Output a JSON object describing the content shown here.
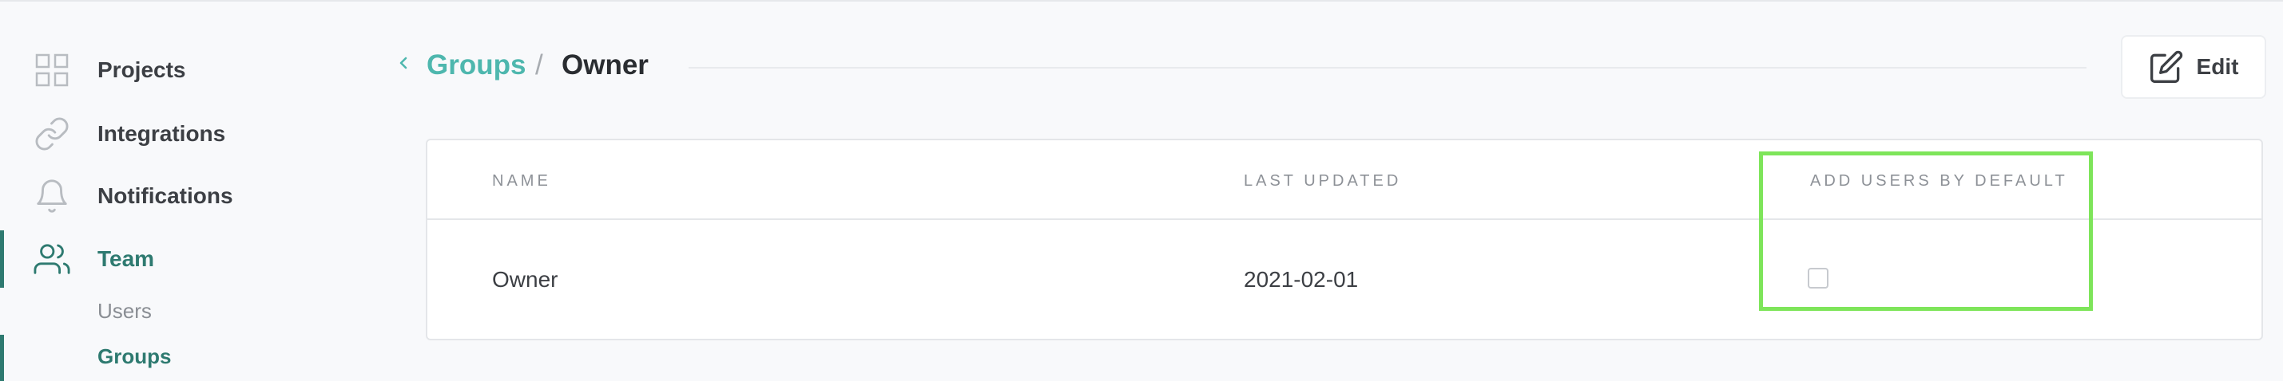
{
  "sidebar": {
    "items": [
      {
        "label": "Projects",
        "icon": "grid-icon"
      },
      {
        "label": "Integrations",
        "icon": "link-icon"
      },
      {
        "label": "Notifications",
        "icon": "bell-icon"
      },
      {
        "label": "Team",
        "icon": "users-icon"
      }
    ],
    "subitems": [
      {
        "label": "Users"
      },
      {
        "label": "Groups"
      }
    ]
  },
  "header": {
    "breadcrumb_link": "Groups",
    "separator": "/",
    "current": "Owner",
    "edit_label": "Edit"
  },
  "table": {
    "columns": [
      "NAME",
      "LAST UPDATED",
      "ADD USERS BY DEFAULT"
    ],
    "rows": [
      {
        "name": "Owner",
        "last_updated": "2021-02-01",
        "add_users_by_default": false
      }
    ]
  },
  "colors": {
    "accent": "#2e7a70",
    "link": "#4eb7ae",
    "highlight": "#7ee55a"
  }
}
